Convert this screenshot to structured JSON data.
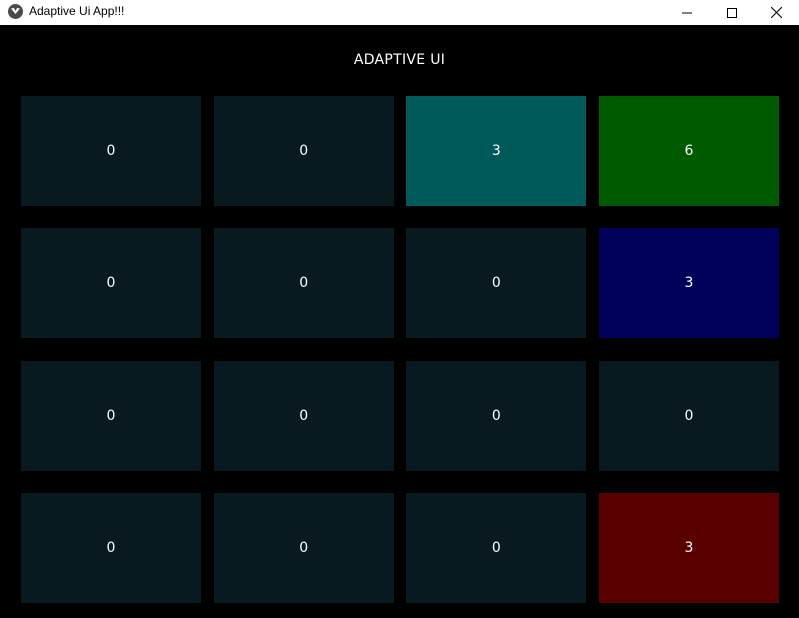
{
  "window": {
    "title": "Adaptive Ui App!!!",
    "app_icon": "kivy-butterfly-icon",
    "controls": {
      "minimize_icon": "minimize-icon",
      "maximize_icon": "maximize-icon",
      "close_icon": "close-icon"
    }
  },
  "header": {
    "title": "ADAPTIVE UI"
  },
  "grid": {
    "rows": 4,
    "columns": 4,
    "tiles": [
      {
        "value": "0",
        "color": "#081a20"
      },
      {
        "value": "0",
        "color": "#081a20"
      },
      {
        "value": "3",
        "color": "#005a5a"
      },
      {
        "value": "6",
        "color": "#005a00"
      },
      {
        "value": "0",
        "color": "#081a20"
      },
      {
        "value": "0",
        "color": "#081a20"
      },
      {
        "value": "0",
        "color": "#081a20"
      },
      {
        "value": "3",
        "color": "#00005a"
      },
      {
        "value": "0",
        "color": "#081a20"
      },
      {
        "value": "0",
        "color": "#081a20"
      },
      {
        "value": "0",
        "color": "#081a20"
      },
      {
        "value": "0",
        "color": "#081a20"
      },
      {
        "value": "0",
        "color": "#081a20"
      },
      {
        "value": "0",
        "color": "#081a20"
      },
      {
        "value": "0",
        "color": "#081a20"
      },
      {
        "value": "3",
        "color": "#5a0000"
      }
    ]
  },
  "colors": {
    "background": "#000000",
    "titlebar": "#ffffff",
    "tile_default": "#081a20",
    "text": "#ffffff"
  }
}
